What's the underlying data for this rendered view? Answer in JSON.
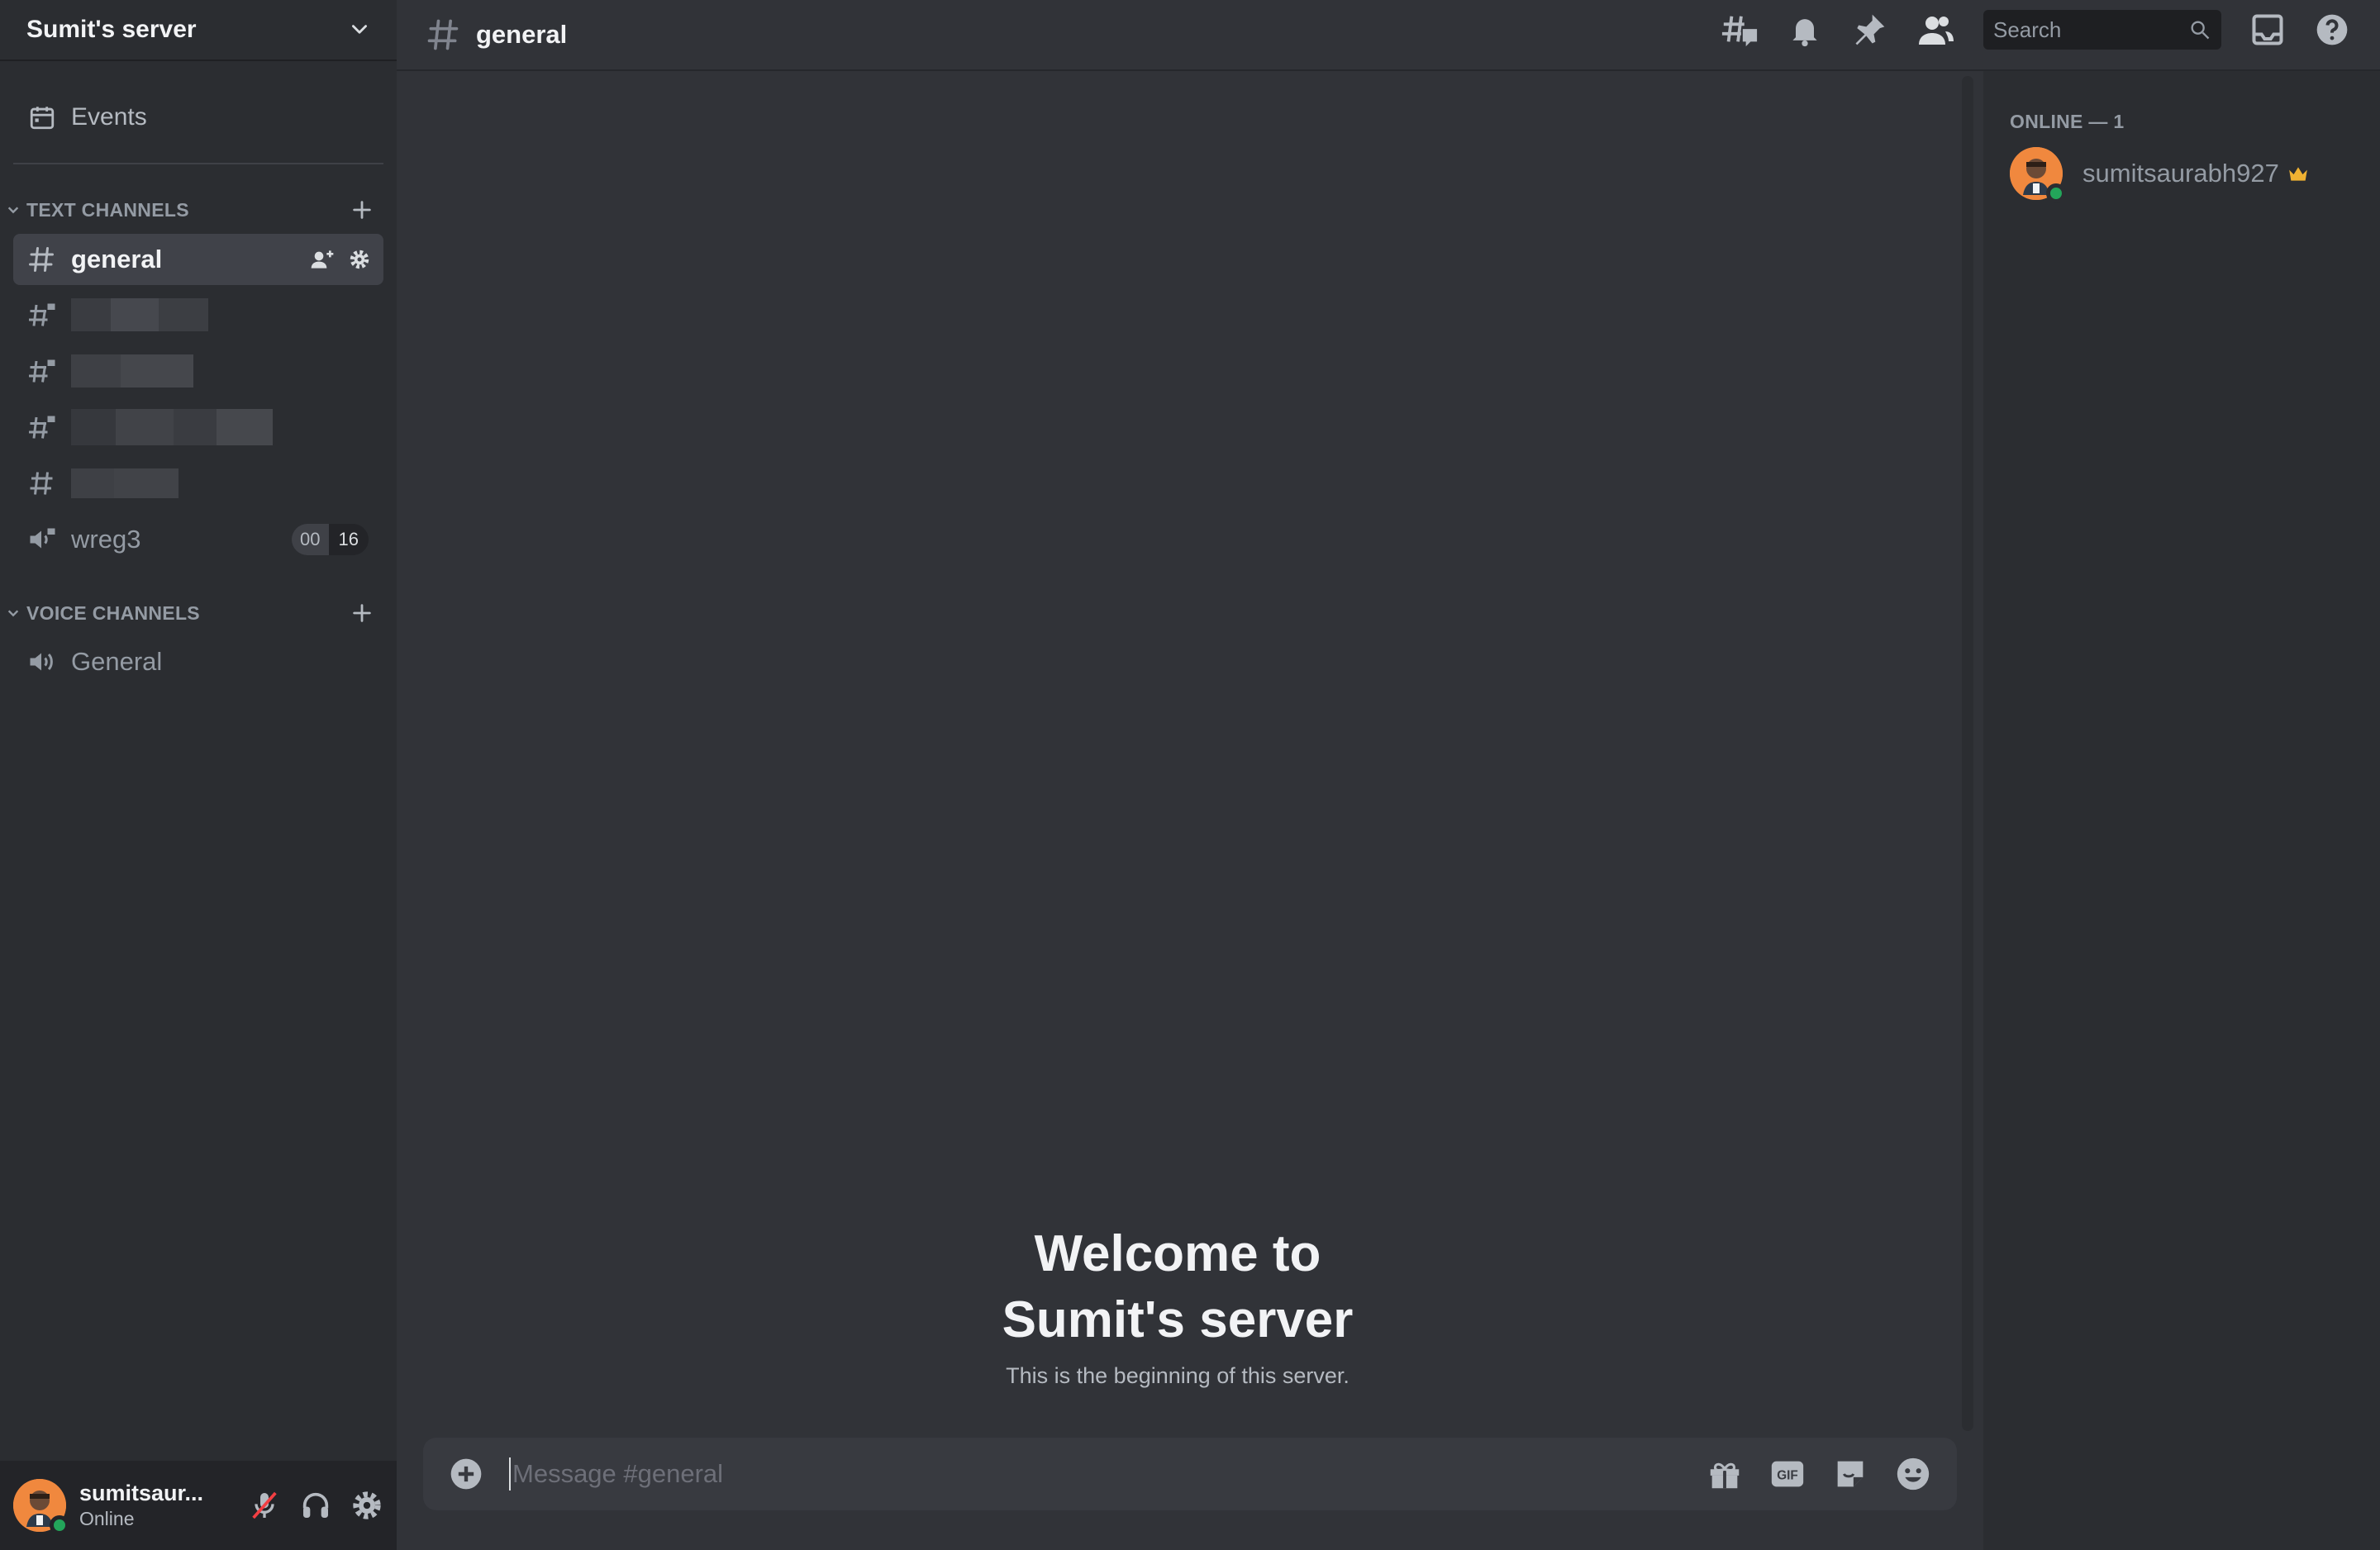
{
  "server": {
    "name": "Sumit's server"
  },
  "sidebar": {
    "events_label": "Events",
    "text_category": "TEXT CHANNELS",
    "voice_category": "VOICE CHANNELS",
    "text_channels": [
      {
        "label": "general",
        "type": "text",
        "active": true
      },
      {
        "label": "",
        "type": "text-locked",
        "redacted": true
      },
      {
        "label": "",
        "type": "text-locked",
        "redacted": true
      },
      {
        "label": "",
        "type": "text-locked",
        "redacted": true
      },
      {
        "label": "",
        "type": "text",
        "redacted": true
      },
      {
        "label": "wreg3",
        "type": "voice-locked",
        "badge_left": "00",
        "badge_right": "16"
      }
    ],
    "voice_channels": [
      {
        "label": "General",
        "type": "voice"
      }
    ]
  },
  "user_panel": {
    "name": "sumitsaur...",
    "status": "Online"
  },
  "topbar": {
    "channel": "general",
    "search_placeholder": "Search"
  },
  "welcome": {
    "line1": "Welcome to",
    "line2": "Sumit's server",
    "subtitle": "This is the beginning of this server."
  },
  "composer": {
    "placeholder": "Message #general"
  },
  "members": {
    "online_header": "ONLINE — 1",
    "list": [
      {
        "name": "sumitsaurabh927",
        "owner": true,
        "status": "online"
      }
    ]
  },
  "colors": {
    "sidebar_bg": "#2b2d31",
    "main_bg": "#313338",
    "online_green": "#23a55a",
    "crown": "#f0b232",
    "avatar_orange": "#f0883e"
  }
}
